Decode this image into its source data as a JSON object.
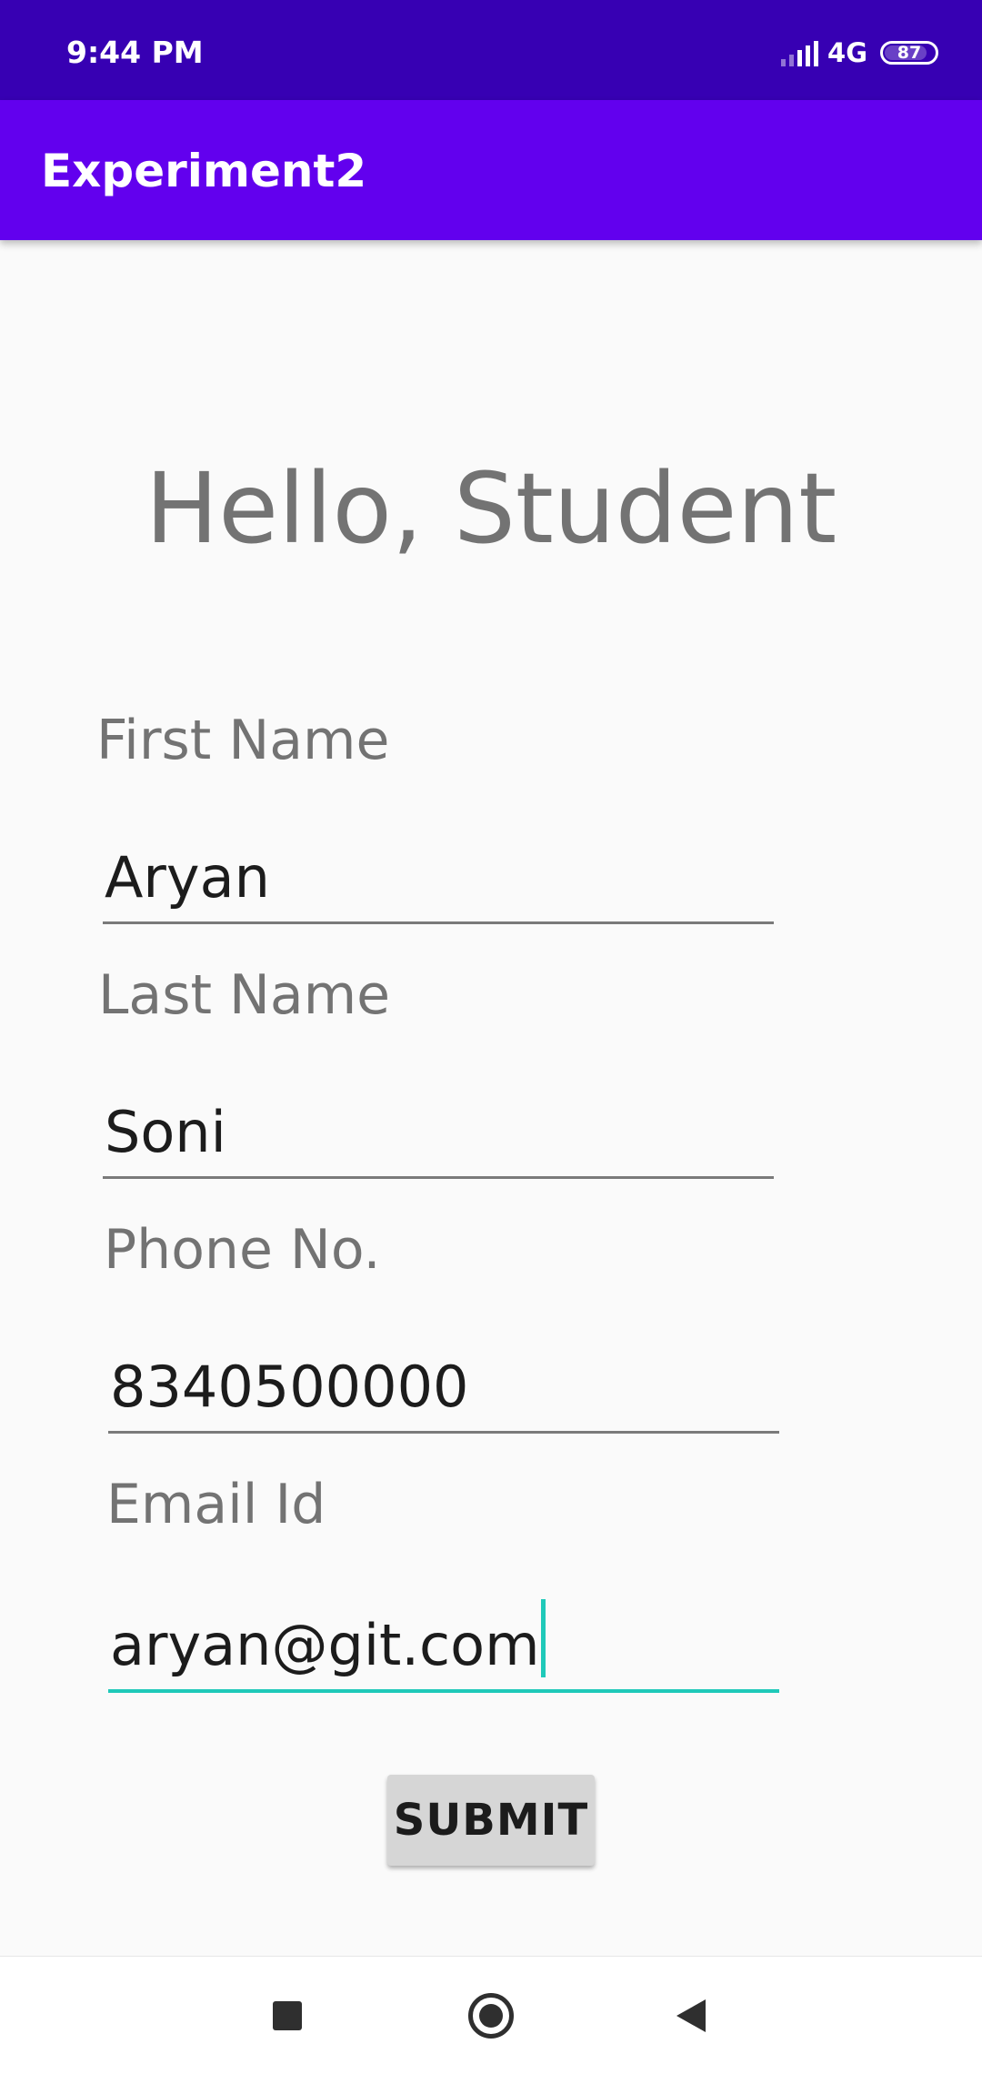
{
  "status_bar": {
    "time": "9:44 PM",
    "network": "4G",
    "battery": "87"
  },
  "app_bar": {
    "title": "Experiment2"
  },
  "greeting": "Hello, Student",
  "form": {
    "first_name": {
      "label": "First Name",
      "value": "Aryan"
    },
    "last_name": {
      "label": "Last Name",
      "value": "Soni"
    },
    "phone": {
      "label": "Phone No.",
      "value": "8340500000"
    },
    "email": {
      "label": "Email Id",
      "value": "aryan@git.com"
    }
  },
  "submit_label": "SUBMIT",
  "nav": {
    "recents_icon": "square-icon",
    "home_icon": "circle-icon",
    "back_icon": "triangle-back-icon"
  },
  "colors": {
    "status_bar": "#3700b3",
    "app_bar": "#6200ee",
    "focus_accent": "#1fc9b9",
    "button": "#d6d6d6"
  }
}
